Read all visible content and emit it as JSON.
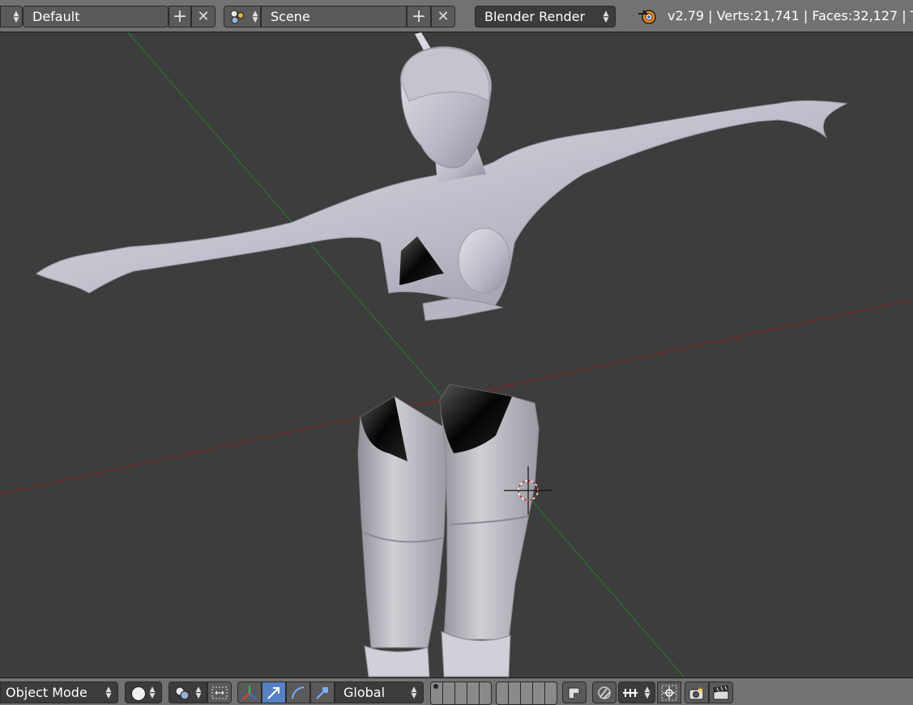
{
  "header": {
    "screen_layout": "Default",
    "scene": "Scene",
    "render_engine": "Blender Render",
    "stats": "v2.79 | Verts:21,741 | Faces:32,127 | T"
  },
  "viewport_header": {
    "mode": "Object Mode",
    "transform_orientation": "Global"
  },
  "icons": {
    "add": "plus-icon",
    "remove": "x-icon",
    "blender_logo": "blender-logo-icon"
  },
  "colors": {
    "viewport_bg": "#3d3d3d",
    "header_bg": "#727272",
    "active_button": "#5680c2",
    "x_axis": "#8b1f1f",
    "y_axis": "#2a7a2a",
    "mesh": "#c9c9d4"
  }
}
